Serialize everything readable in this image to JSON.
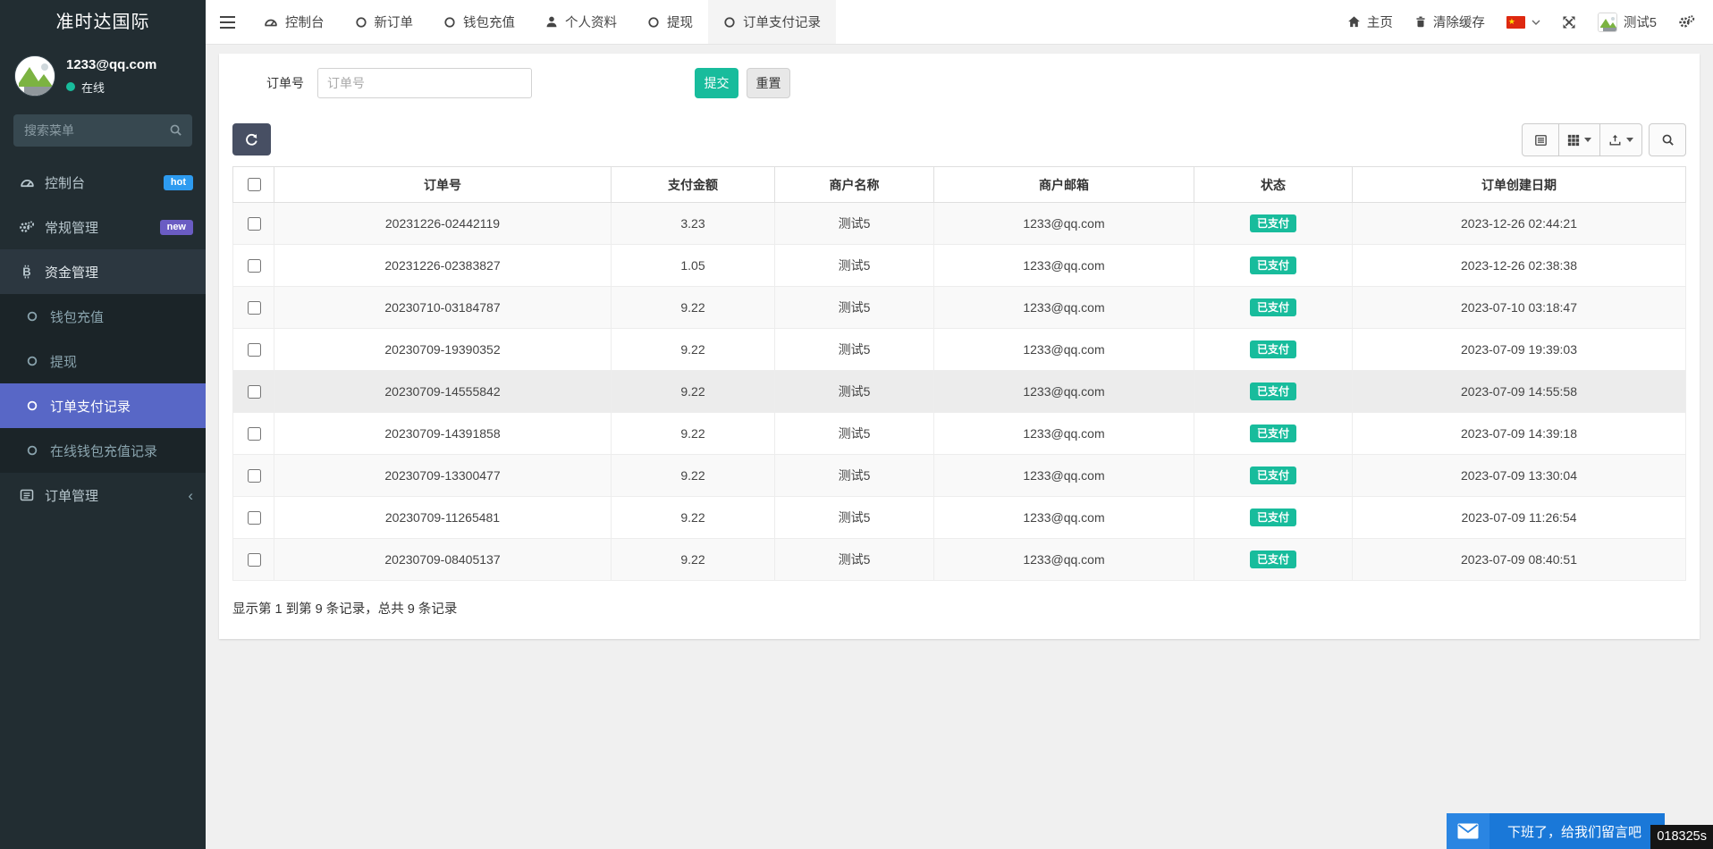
{
  "sidebar": {
    "brand": "准时达国际",
    "user": {
      "email": "1233@qq.com",
      "status": "在线"
    },
    "search_placeholder": "搜索菜单",
    "items": [
      {
        "label": "控制台",
        "badge": "hot"
      },
      {
        "label": "常规管理",
        "badge": "new"
      },
      {
        "label": "资金管理"
      },
      {
        "label": "钱包充值"
      },
      {
        "label": "提现"
      },
      {
        "label": "订单支付记录"
      },
      {
        "label": "在线钱包充值记录"
      },
      {
        "label": "订单管理"
      }
    ]
  },
  "topbar": {
    "tabs": [
      {
        "label": "控制台"
      },
      {
        "label": "新订单"
      },
      {
        "label": "钱包充值"
      },
      {
        "label": "个人资料"
      },
      {
        "label": "提现"
      },
      {
        "label": "订单支付记录"
      }
    ],
    "home_label": "主页",
    "clear_cache_label": "清除缓存",
    "username": "测试5"
  },
  "filter": {
    "label": "订单号",
    "placeholder": "订单号",
    "submit_label": "提交",
    "reset_label": "重置"
  },
  "table": {
    "columns": [
      "订单号",
      "支付金额",
      "商户名称",
      "商户邮箱",
      "状态",
      "订单创建日期"
    ],
    "rows": [
      {
        "order_no": "20231226-02442119",
        "amount": "3.23",
        "merchant": "测试5",
        "email": "1233@qq.com",
        "status": "已支付",
        "created": "2023-12-26 02:44:21"
      },
      {
        "order_no": "20231226-02383827",
        "amount": "1.05",
        "merchant": "测试5",
        "email": "1233@qq.com",
        "status": "已支付",
        "created": "2023-12-26 02:38:38"
      },
      {
        "order_no": "20230710-03184787",
        "amount": "9.22",
        "merchant": "测试5",
        "email": "1233@qq.com",
        "status": "已支付",
        "created": "2023-07-10 03:18:47"
      },
      {
        "order_no": "20230709-19390352",
        "amount": "9.22",
        "merchant": "测试5",
        "email": "1233@qq.com",
        "status": "已支付",
        "created": "2023-07-09 19:39:03"
      },
      {
        "order_no": "20230709-14555842",
        "amount": "9.22",
        "merchant": "测试5",
        "email": "1233@qq.com",
        "status": "已支付",
        "created": "2023-07-09 14:55:58",
        "highlighted": true
      },
      {
        "order_no": "20230709-14391858",
        "amount": "9.22",
        "merchant": "测试5",
        "email": "1233@qq.com",
        "status": "已支付",
        "created": "2023-07-09 14:39:18"
      },
      {
        "order_no": "20230709-13300477",
        "amount": "9.22",
        "merchant": "测试5",
        "email": "1233@qq.com",
        "status": "已支付",
        "created": "2023-07-09 13:30:04"
      },
      {
        "order_no": "20230709-11265481",
        "amount": "9.22",
        "merchant": "测试5",
        "email": "1233@qq.com",
        "status": "已支付",
        "created": "2023-07-09 11:26:54"
      },
      {
        "order_no": "20230709-08405137",
        "amount": "9.22",
        "merchant": "测试5",
        "email": "1233@qq.com",
        "status": "已支付",
        "created": "2023-07-09 08:40:51"
      }
    ],
    "summary": "显示第 1 到第 9 条记录，总共 9 条记录"
  },
  "chat": {
    "message": "下班了，给我们留言吧",
    "timer": "018325s"
  },
  "colors": {
    "accent_teal": "#18bc9c",
    "active_menu_blue": "#5867c6",
    "badge_hot_blue": "#2d9bf0",
    "badge_new_purple": "#6a5cc3",
    "chat_blue": "#1a78d8",
    "sidebar_dark": "#222d32",
    "refresh_button_dark": "#474f63"
  }
}
